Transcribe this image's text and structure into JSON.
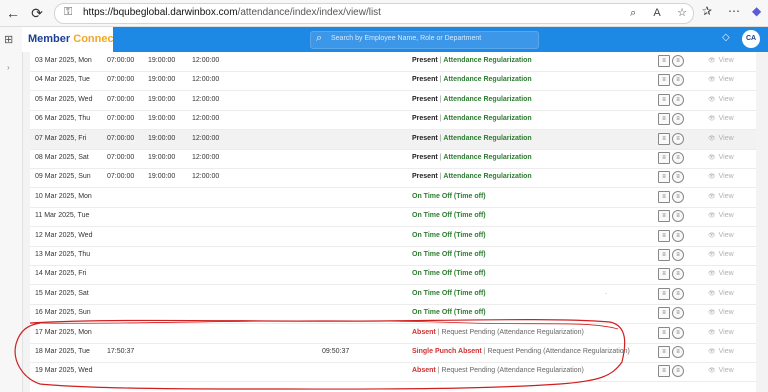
{
  "browser": {
    "back": "←",
    "reload": "⟳",
    "lock": "⚿",
    "url_host": "https://bqubeglobal.darwinbox.com",
    "url_path": "/attendance/index/index/view/list",
    "url_icons": [
      "⌕",
      "A",
      "☆"
    ],
    "right_icons": [
      "✰",
      "⋯",
      "◆"
    ]
  },
  "rail": {
    "grid_icon": "⊞",
    "arrow": "›"
  },
  "header": {
    "brand_part1": "Member",
    "brand_part2": "Connect",
    "search_placeholder": "Search by Employee Name, Role or Department",
    "search_icon": "⌕",
    "bell_icon": "◇",
    "avatar_initials": "CA"
  },
  "actions": {
    "doc_icon": "≡",
    "circle_icon": "≡",
    "view_label": "View",
    "view_icon": "👁"
  },
  "rows": [
    {
      "date": "03 Mar 2025, Mon",
      "t1": "07:00:00",
      "t2": "19:00:00",
      "t3": "12:00:00",
      "t4": "",
      "status": "Present",
      "sep": " | ",
      "detail": "Attendance Regularization",
      "kind": "present"
    },
    {
      "date": "04 Mar 2025, Tue",
      "t1": "07:00:00",
      "t2": "19:00:00",
      "t3": "12:00:00",
      "t4": "",
      "status": "Present",
      "sep": " | ",
      "detail": "Attendance Regularization",
      "kind": "present"
    },
    {
      "date": "05 Mar 2025, Wed",
      "t1": "07:00:00",
      "t2": "19:00:00",
      "t3": "12:00:00",
      "t4": "",
      "status": "Present",
      "sep": " | ",
      "detail": "Attendance Regularization",
      "kind": "present"
    },
    {
      "date": "06 Mar 2025, Thu",
      "t1": "07:00:00",
      "t2": "19:00:00",
      "t3": "12:00:00",
      "t4": "",
      "status": "Present",
      "sep": " | ",
      "detail": "Attendance Regularization",
      "kind": "present"
    },
    {
      "date": "07 Mar 2025, Fri",
      "t1": "07:00:00",
      "t2": "19:00:00",
      "t3": "12:00:00",
      "t4": "",
      "status": "Present",
      "sep": " | ",
      "detail": "Attendance Regularization",
      "kind": "present",
      "alt": true
    },
    {
      "date": "08 Mar 2025, Sat",
      "t1": "07:00:00",
      "t2": "19:00:00",
      "t3": "12:00:00",
      "t4": "",
      "status": "Present",
      "sep": " | ",
      "detail": "Attendance Regularization",
      "kind": "present"
    },
    {
      "date": "09 Mar 2025, Sun",
      "t1": "07:00:00",
      "t2": "19:00:00",
      "t3": "12:00:00",
      "t4": "",
      "status": "Present",
      "sep": " | ",
      "detail": "Attendance Regularization",
      "kind": "present"
    },
    {
      "date": "10 Mar 2025, Mon",
      "t1": "",
      "t2": "",
      "t3": "",
      "t4": "",
      "status": "On Time Off (Time off)",
      "sep": "",
      "detail": "",
      "kind": "ontime"
    },
    {
      "date": "11 Mar 2025, Tue",
      "t1": "",
      "t2": "",
      "t3": "",
      "t4": "",
      "status": "On Time Off (Time off)",
      "sep": "",
      "detail": "",
      "kind": "ontime"
    },
    {
      "date": "12 Mar 2025, Wed",
      "t1": "",
      "t2": "",
      "t3": "",
      "t4": "",
      "status": "On Time Off (Time off)",
      "sep": "",
      "detail": "",
      "kind": "ontime"
    },
    {
      "date": "13 Mar 2025, Thu",
      "t1": "",
      "t2": "",
      "t3": "",
      "t4": "",
      "status": "On Time Off (Time off)",
      "sep": "",
      "detail": "",
      "kind": "ontime"
    },
    {
      "date": "14 Mar 2025, Fri",
      "t1": "",
      "t2": "",
      "t3": "",
      "t4": "",
      "status": "On Time Off (Time off)",
      "sep": "",
      "detail": "",
      "kind": "ontime"
    },
    {
      "date": "15 Mar 2025, Sat",
      "t1": "",
      "t2": "",
      "t3": "",
      "t4": "",
      "status": "On Time Off (Time off)",
      "sep": "",
      "detail": "",
      "kind": "ontime",
      "dot": "."
    },
    {
      "date": "16 Mar 2025, Sun",
      "t1": "",
      "t2": "",
      "t3": "",
      "t4": "",
      "status": "On Time Off (Time off)",
      "sep": "",
      "detail": "",
      "kind": "ontime"
    },
    {
      "date": "17 Mar 2025, Mon",
      "t1": "",
      "t2": "",
      "t3": "",
      "t4": "",
      "status": "Absent",
      "sep": " | ",
      "detail": "Request Pending (Attendance Regularization)",
      "kind": "absent"
    },
    {
      "date": "18 Mar 2025, Tue",
      "t1": "17:50:37",
      "t2": "",
      "t3": "",
      "t4": "09:50:37",
      "status": "Single Punch Absent",
      "sep": " | ",
      "detail": "Request Pending (Attendance Regularization)",
      "kind": "absent"
    },
    {
      "date": "19 Mar 2025, Wed",
      "t1": "",
      "t2": "",
      "t3": "",
      "t4": "",
      "status": "Absent",
      "sep": " | ",
      "detail": "Request Pending (Attendance Regularization)",
      "kind": "absent"
    }
  ]
}
